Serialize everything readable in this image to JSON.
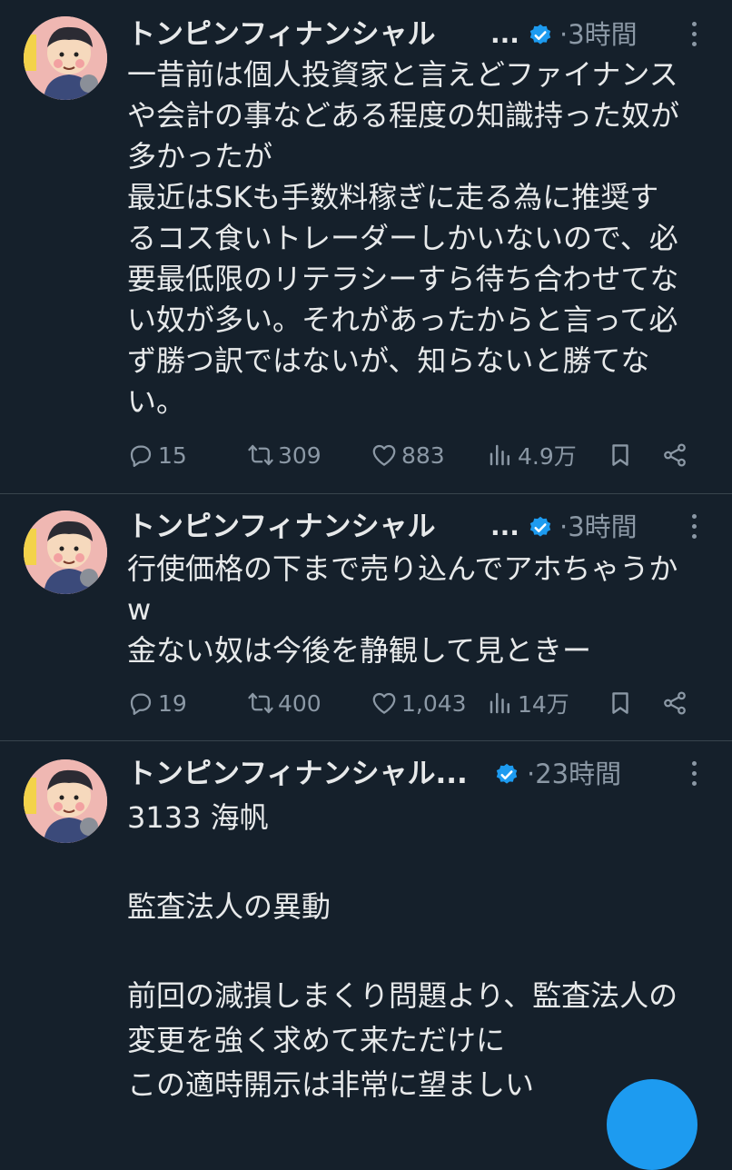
{
  "tweets": [
    {
      "author": "トンピンフィナンシャル",
      "ellipsis": "...",
      "time": "·3時間",
      "text": "一昔前は個人投資家と言えどファイナンス\nや会計の事などある程度の知識持った奴が\n多かったが\n最近はSKも手数料稼ぎに走る為に推奨す\nるコス食いトレーダーしかいないので、必\n要最低限のリテラシーすら待ち合わせてな\nい奴が多い。それがあったからと言って必\nず勝つ訳ではないが、知らないと勝てな\nい。",
      "replies": "15",
      "retweets": "309",
      "likes": "883",
      "views": "4.9万"
    },
    {
      "author": "トンピンフィナンシャル",
      "ellipsis": "...",
      "time": "·3時間",
      "text": "行使価格の下まで売り込んでアホちゃうか\nw\n金ない奴は今後を静観して見ときー",
      "replies": "19",
      "retweets": "400",
      "likes": "1,043",
      "views": "14万"
    },
    {
      "author": "トンピンフィナンシャル...",
      "ellipsis": "",
      "time": "·23時間",
      "text": "3133 海帆\n\n監査法人の異動\n\n前回の減損しまくり問題より、監査法人の\n変更を強く求めて来ただけに\nこの適時開示は非常に望ましい",
      "replies": "",
      "retweets": "",
      "likes": "",
      "views": ""
    }
  ],
  "colors": {
    "background": "#15202b",
    "text": "#e7e9ea",
    "muted": "#8b98a5",
    "verified": "#1d9bf0",
    "divider": "#38444d"
  },
  "icons": [
    "reply-icon",
    "retweet-icon",
    "like-icon",
    "views-icon",
    "bookmark-icon",
    "share-icon",
    "verified-badge-icon",
    "more-options-icon"
  ]
}
